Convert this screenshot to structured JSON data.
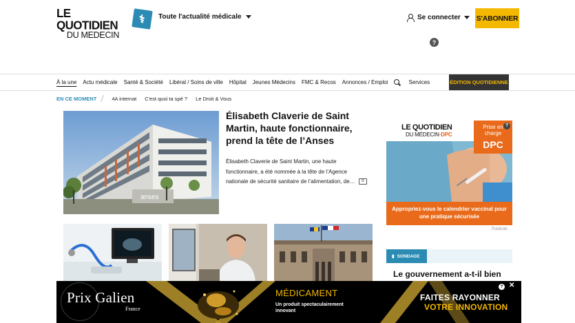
{
  "header": {
    "logo_line1": "LE QUOTIDIEN",
    "logo_line2": "DU MEDECIN",
    "logo_icon": "caduceus-icon",
    "section_dropdown": "Toute l'actualité médicale",
    "login_label": "Se connecter",
    "subscribe_label": "S'ABONNER",
    "help_icon": "?"
  },
  "nav": {
    "items": [
      "À la une",
      "Actu médicale",
      "Santé & Société",
      "Libéral / Soins de ville",
      "Hôpital",
      "Jeunes Médecins",
      "FMC & Recos",
      "Annonces / Emploi"
    ],
    "services_label": "Services",
    "edition_label": "ÉDITION QUOTIDIENNE"
  },
  "subnav": {
    "label": "EN CE MOMENT",
    "items": [
      "4A internat",
      "C'est quoi ta spé ?",
      "Le Droit & Vous"
    ]
  },
  "main_article": {
    "title": "Élisabeth Claverie de Saint Martin, haute fonctionnaire, prend la tête de l’Anses",
    "excerpt": "Élisabeth Claverie de Saint Martin, une haute fonctionnaire, a été nommée à la tête de l’Agence nationale de sécurité sanitaire de l’alimentation, de…",
    "comment_count": "0",
    "image_caption_text": "anses"
  },
  "ad_dpc": {
    "logo_line1": "LE QUOTIDIEN",
    "logo_line2_prefix": "DU MÉDECIN",
    "logo_line2_suffix": "·DPC",
    "prise_en_charge": "Prise en charge",
    "dpc": "DPC",
    "cta": "Appropriez-vous le calendrier vaccinal pour une pratique sécurisée",
    "publicite": "Publicité"
  },
  "sondage": {
    "tag": "SONDAGE",
    "question": "Le gouvernement a-t-il bien"
  },
  "banner": {
    "brand": "Prix Galien",
    "brand_sub": "France",
    "title": "MÉDICAMENT",
    "subtitle": "Un produit spectaculairement innovant",
    "cta_line1": "FAITES RAYONNER",
    "cta_line2": "VOTRE INNOVATION"
  },
  "colors": {
    "accent_blue": "#2b8bb3",
    "accent_yellow": "#f5b800",
    "accent_orange": "#e86a1a"
  }
}
